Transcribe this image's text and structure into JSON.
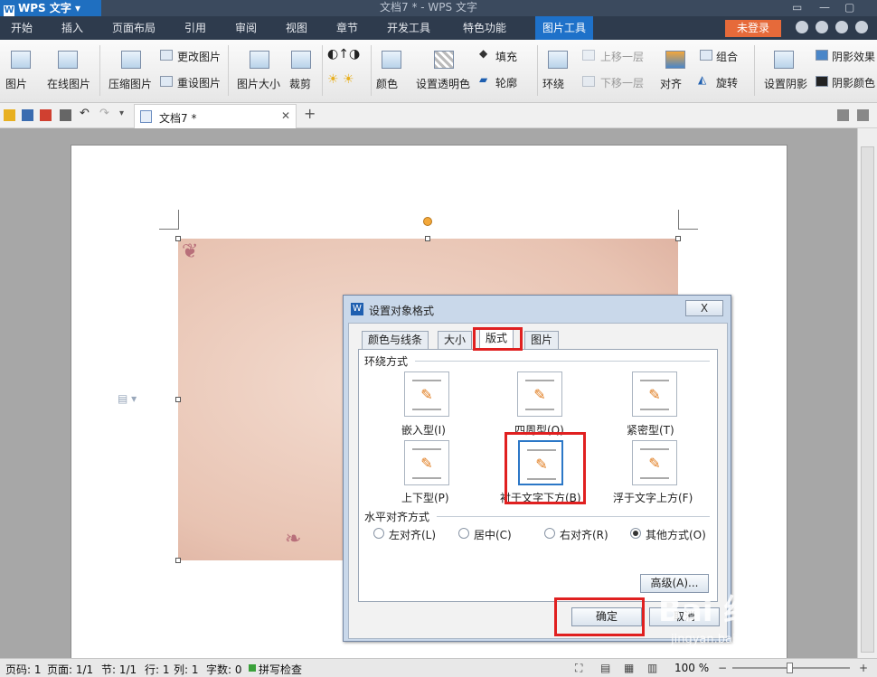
{
  "app": {
    "name": "WPS 文字",
    "window_title": "文档7 * - WPS 文字"
  },
  "menu": {
    "items": [
      "开始",
      "插入",
      "页面布局",
      "引用",
      "审阅",
      "视图",
      "章节",
      "开发工具",
      "特色功能",
      "图片工具"
    ],
    "active": "图片工具",
    "login_label": "未登录"
  },
  "ribbon": {
    "picture": "图片",
    "online_picture": "在线图片",
    "compress": "压缩图片",
    "change_picture": "更改图片",
    "reset_picture": "重设图片",
    "picture_size": "图片大小",
    "crop": "裁剪",
    "color": "颜色",
    "set_transparent": "设置透明色",
    "fill": "填充",
    "outline": "轮廓",
    "wrap": "环绕",
    "bring_forward": "上移一层",
    "send_backward": "下移一层",
    "align": "对齐",
    "group": "组合",
    "rotate": "旋转",
    "set_shadow": "设置阴影",
    "shadow_effect": "阴影效果",
    "shadow_color": "阴影颜色"
  },
  "doc_tab": {
    "title": "文档7 *"
  },
  "dialog": {
    "title": "设置对象格式",
    "close_label": "X",
    "tabs": [
      "颜色与线条",
      "大小",
      "版式",
      "图片"
    ],
    "active_tab": "版式",
    "wrap_section": "环绕方式",
    "wrap_options": [
      "嵌入型(I)",
      "四周型(Q)",
      "紧密型(T)",
      "上下型(P)",
      "衬于文字下方(B)",
      "浮于文字上方(F)"
    ],
    "wrap_selected": "衬于文字下方(B)",
    "halign_section": "水平对齐方式",
    "halign_options": [
      "左对齐(L)",
      "居中(C)",
      "右对齐(R)",
      "其他方式(O)"
    ],
    "halign_selected": "其他方式(O)",
    "advanced_label": "高级(A)...",
    "ok_label": "确定",
    "cancel_label": "取消"
  },
  "status": {
    "page_no": "页码: 1",
    "pages": "页面: 1/1",
    "section": "节: 1/1",
    "row": "行: 1",
    "col": "列: 1",
    "words": "字数: 0",
    "spell": "拼写检查",
    "zoom": "100 %"
  },
  "watermark": {
    "brand": "Bai 经验",
    "url": "jingyan.baidu.com"
  },
  "colors": {
    "accent": "#1e71c9",
    "highlight": "#e02020",
    "login": "#e66a3a"
  }
}
